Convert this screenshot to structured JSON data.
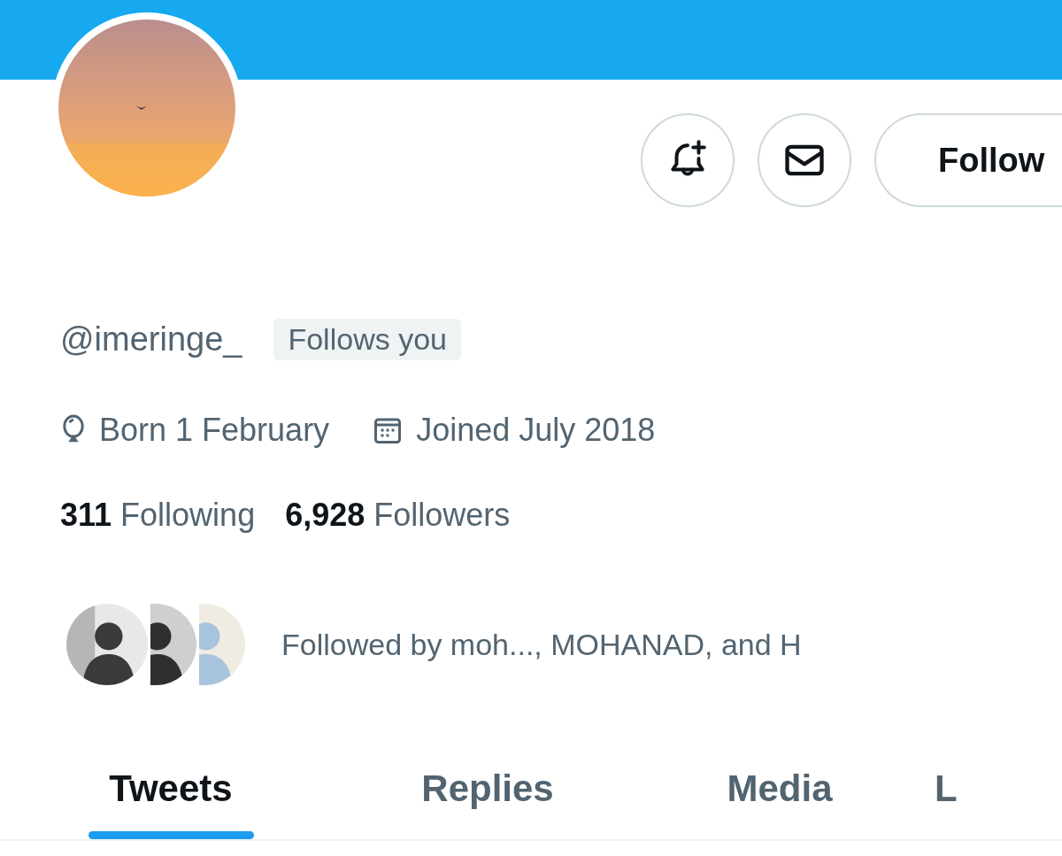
{
  "profile": {
    "follow_button": "Follow",
    "handle": "@imeringe_",
    "follows_you_badge": "Follows you",
    "birthday": "Born 1 February",
    "joined": "Joined July 2018",
    "following_count": "311",
    "following_label": "Following",
    "followers_count": "6,928",
    "followers_label": "Followers",
    "followed_by": "Followed by moh..., MOHANAD, and H"
  },
  "tabs": [
    {
      "label": "Tweets",
      "selected": true
    },
    {
      "label": "Replies",
      "selected": false
    },
    {
      "label": "Media",
      "selected": false
    },
    {
      "label": "L",
      "selected": false
    }
  ]
}
